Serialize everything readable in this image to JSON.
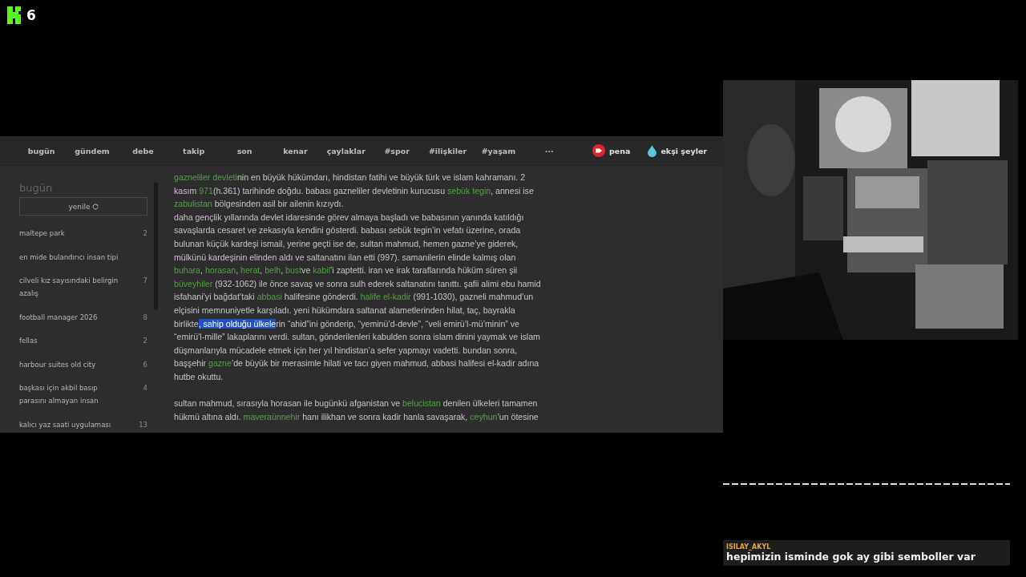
{
  "overlay": {
    "logo_count": "6"
  },
  "nav": {
    "items": [
      "bugün",
      "gündem",
      "debe",
      "takip",
      "son",
      "kenar",
      "çaylaklar",
      "#spor",
      "#ilişkiler",
      "#yaşam",
      "···"
    ],
    "pena": "pena",
    "eksi_seyler": "ekşi şeyler"
  },
  "sidebar": {
    "title": "bugün",
    "refresh": "yenile",
    "items": [
      {
        "title": "maltepe park",
        "count": "2"
      },
      {
        "title": "en mide bulandırıcı insan tipi"
      },
      {
        "title": "cilveli kız sayısındaki belirgin azalış",
        "count": "7"
      },
      {
        "title": "football manager 2026",
        "count": "8"
      },
      {
        "title": "fellas",
        "count": "2"
      },
      {
        "title": "harbour suites old city",
        "count": "6"
      },
      {
        "title": "başkası için akbil basıp parasını almayan insan",
        "count": "4"
      },
      {
        "title": "kalıcı yaz saati uygulaması",
        "count": "13"
      }
    ]
  },
  "entry": {
    "paragraphs": [
      [
        {
          "text": "gazneliler devleti",
          "link": true
        },
        {
          "text": "nin en büyük hükümdarı, hindistan fatihi ve büyük türk ve islam kahramanı. 2 kasım "
        },
        {
          "text": "971",
          "link": true
        },
        {
          "text": "(h.361) tarihinde doğdu. babası gazneliler devletinin kurucusu "
        },
        {
          "text": "sebük tegin",
          "link": true
        },
        {
          "text": ", annesi ise "
        },
        {
          "text": "zabulistan",
          "link": true
        },
        {
          "text": " bölgesinden asil bir ailenin kızıydı."
        }
      ],
      [
        {
          "text": "daha gençlik yıllarında devlet idaresinde görev almaya başladı ve babasının yanında katıldığı savaşlarda cesaret ve zekasıyla kendini gösterdi. babası sebük tegin’in vefatı üzerine, orada bulunan küçük kardeşi ismail, yerine geçti ise de, sultan mahmud, hemen gazne’ye giderek, mülkünü kardeşinin elinden aldı ve saltanatını ilan etti (997). samanilerin elinde kalmış olan "
        },
        {
          "text": "buhara",
          "link": true
        },
        {
          "text": ", "
        },
        {
          "text": "horasan",
          "link": true
        },
        {
          "text": ", "
        },
        {
          "text": "herat",
          "link": true
        },
        {
          "text": ", "
        },
        {
          "text": "belh",
          "link": true
        },
        {
          "text": ", "
        },
        {
          "text": "bust",
          "link": true
        },
        {
          "text": "ve "
        },
        {
          "text": "kabil",
          "link": true
        },
        {
          "text": "’i zaptetti. iran ve irak taraflarında hüküm süren şii "
        },
        {
          "text": "büveyhiler",
          "link": true
        },
        {
          "text": " (932-1062) ile önce savaş ve sonra sulh ederek saltanatını tanıttı. şafii alimi ebu hamid isfahani’yi bağdat’taki "
        },
        {
          "text": "abbasi",
          "link": true
        },
        {
          "text": " halifesine gönderdi. "
        },
        {
          "text": "halife el-kadir",
          "link": true
        },
        {
          "text": " (991-1030), gazneli mahmud’un elçisini memnuniyetle karşıladı. yeni hükümdara saltanat alametlerinden hilat, taç, bayrakla birlikte"
        },
        {
          "text": ", sahip olduğu ülkele",
          "highlighted": true
        },
        {
          "text": "rin “ahid”ini gönderip, “yeminü’d-devle”, “veli emirü’l-mü’minin” ve “emirü’l-mille” lakaplarını verdi. sultan, gönderilenleri kabulden sonra islam dinini yaymak ve islam düşmanlarıyla mücadele etmek için her yıl hindistan’a sefer yapmayı vadetti. bundan sonra, başşehir "
        },
        {
          "text": "gazne",
          "link": true
        },
        {
          "text": "’de büyük bir merasimle hilati ve tacı giyen mahmud, abbasi halifesi el-kadir adına hutbe okuttu."
        }
      ],
      [
        {
          "text": "sultan mahmud, sırasıyla horasan ile bugünkü afganistan ve "
        },
        {
          "text": "belucistan",
          "link": true
        },
        {
          "text": " denilen ülkeleri tamamen hükmü altına aldı. "
        },
        {
          "text": "maveraünnehir",
          "link": true
        },
        {
          "text": " hanı ilikhan ve sonra kadir hanla savaşarak, "
        },
        {
          "text": "ceyhun",
          "link": true
        },
        {
          "text": "’un ötesine"
        }
      ]
    ]
  },
  "chat": {
    "username": "ISILAY_AKYL",
    "message": "hepimizin isminde gok ay gibi semboller var"
  }
}
